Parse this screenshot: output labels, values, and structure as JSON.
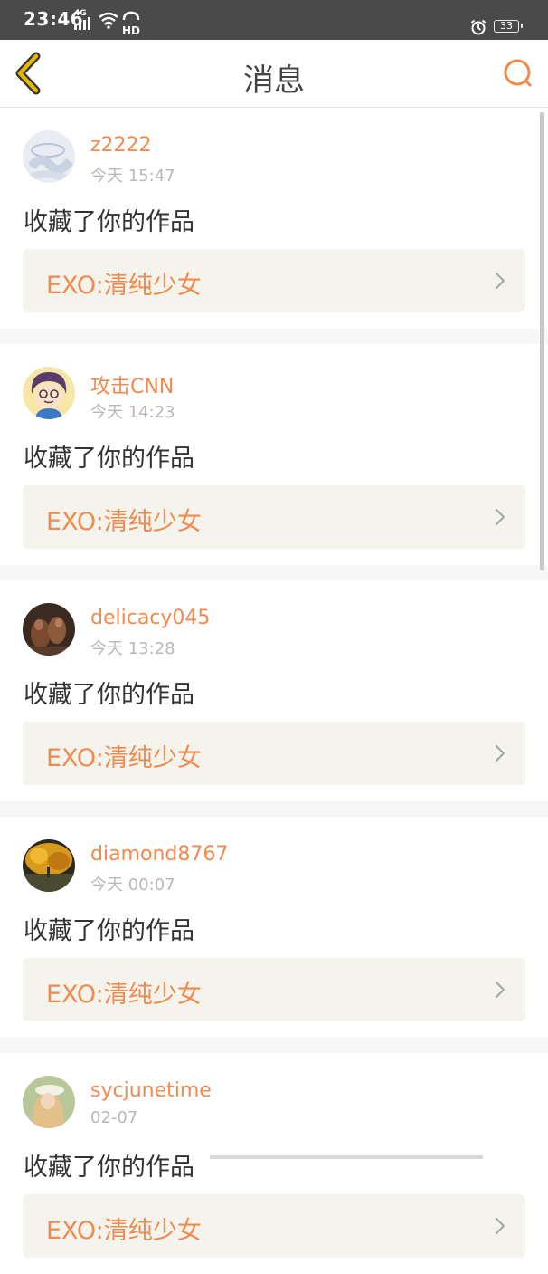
{
  "status_bar": {
    "time": "23:46",
    "network": "4G",
    "hd": "HD",
    "battery": "33"
  },
  "header": {
    "title": "消息"
  },
  "messages": [
    {
      "username": "z2222",
      "time": "今天 15:47",
      "action": "收藏了你的作品",
      "work_title": "EXO:清纯少女"
    },
    {
      "username": "攻击CNN",
      "time": "今天 14:23",
      "action": "收藏了你的作品",
      "work_title": "EXO:清纯少女"
    },
    {
      "username": "delicacy045",
      "time": "今天 13:28",
      "action": "收藏了你的作品",
      "work_title": "EXO:清纯少女"
    },
    {
      "username": "diamond8767",
      "time": "今天 00:07",
      "action": "收藏了你的作品",
      "work_title": "EXO:清纯少女"
    },
    {
      "username": "sycjunetime",
      "time": "02-07",
      "action": "收藏了你的作品",
      "work_title": "EXO:清纯少女"
    }
  ],
  "colors": {
    "accent": "#f08a4e",
    "back_icon": "#e6b800",
    "status_bar": "#4a4a4a",
    "card_link_bg": "#f4f4ec"
  },
  "icons": {
    "back": "chevron-left-icon",
    "search": "search-icon",
    "item_arrow": "chevron-right-icon"
  }
}
